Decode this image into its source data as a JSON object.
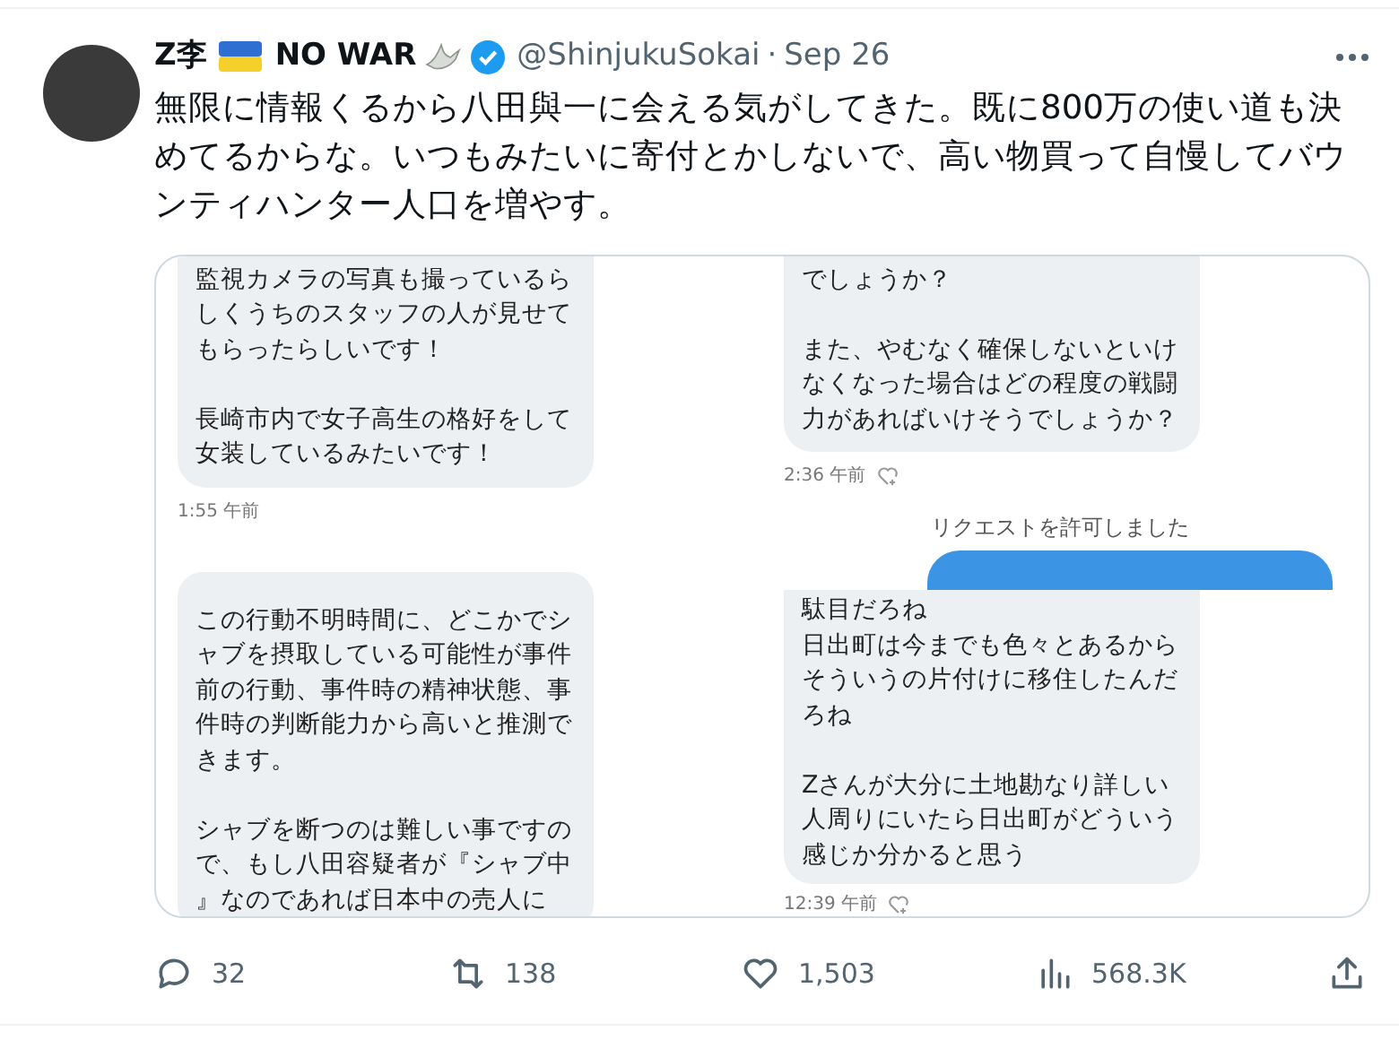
{
  "tweet": {
    "author": {
      "name": "Z李",
      "flag": true,
      "label": "NO WAR",
      "dove": true,
      "verified": true,
      "handle": "@ShinjukuSokai",
      "separator": "·",
      "date": "Sep 26"
    },
    "text": "無限に情報くるから八田與一に会える気がしてきた。既に800万の使い道も決めてるからな。いつもみたいに寄付とかしないで、高い物買って自慢してバウンティハンター人口を増やす。",
    "image": {
      "columns": [
        [
          {
            "kind": "incoming",
            "paragraphs": [
              [
                "監視カメラの写真も撮っているらしくうちのスタッフの人が見せてもらったらしいです！"
              ],
              [
                "長崎市内で女子高生の格好をして女装しているみたいです！"
              ]
            ]
          },
          {
            "kind": "timestamp",
            "text": "1:55 午前",
            "reaction": false
          },
          {
            "kind": "incoming"
          },
          {
            "kind": "incoming",
            "paragraphs": [
              [
                "この行動不明時間に、どこかでシャブを摂取している可能性が事件前の行動、事件時の精神状態、事件時の判断能力から高いと推測できます。"
              ],
              [
                "シャブを断つのは難しい事ですので、もし八田容疑者が『シャブ中』なのであれば日本中の売人に"
              ]
            ]
          }
        ],
        [
          {
            "kind": "incoming",
            "paragraphs": [
              [
                "でしょうか？"
              ],
              [
                "また、やむなく確保しないといけなくなった場合はどの程度の戦闘力があればいけそうでしょうか？"
              ]
            ]
          },
          {
            "kind": "timestamp",
            "text": "2:36 午前",
            "reaction": true
          },
          {
            "kind": "notice",
            "text": "リクエストを許可しました"
          },
          {
            "kind": "outgoing"
          },
          {
            "kind": "incoming",
            "paragraphs": [
              [
                "駄目だろね",
                "日出町は今までも色々とあるからそういうの片付けに移住したんだろね"
              ],
              [
                "Zさんが大分に土地勘なり詳しい人周りにいたら日出町がどういう感じか分かると思う"
              ]
            ]
          },
          {
            "kind": "timestamp",
            "text": "12:39 午前",
            "reaction": true
          }
        ]
      ]
    }
  },
  "actions": [
    {
      "kind": "reply",
      "count": "32"
    },
    {
      "kind": "repost",
      "count": "138"
    },
    {
      "kind": "like",
      "count": "1,503"
    },
    {
      "kind": "views",
      "count": "568.3K"
    },
    {
      "kind": "share"
    }
  ]
}
